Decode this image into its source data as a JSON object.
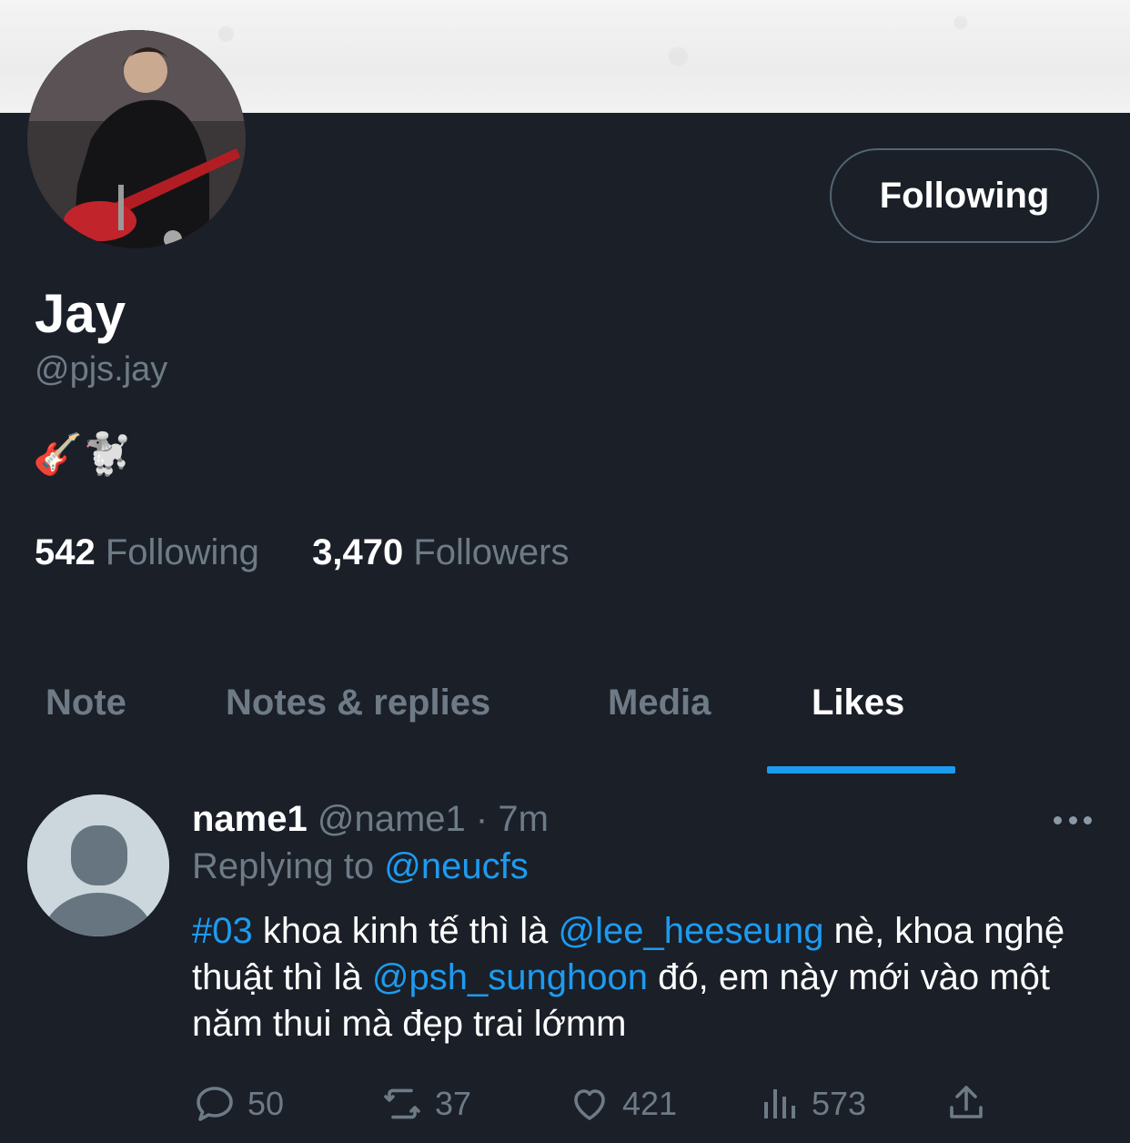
{
  "profile": {
    "display_name": "Jay",
    "handle": "@pjs.jay",
    "bio": "🎸🐩",
    "follow_button_label": "Following",
    "following_count": "542",
    "following_label": "Following",
    "followers_count": "3,470",
    "followers_label": "Followers"
  },
  "tabs": [
    {
      "label": "Note",
      "active": false
    },
    {
      "label": "Notes & replies",
      "active": false
    },
    {
      "label": "Media",
      "active": false
    },
    {
      "label": "Likes",
      "active": true
    }
  ],
  "post": {
    "author_name": "name1",
    "author_handle": "@name1",
    "separator": "·",
    "time": "7m",
    "replying_prefix": "Replying to",
    "replying_to": "@neucfs",
    "text_parts": [
      {
        "text": "#03",
        "link": true
      },
      {
        "text": " khoa kinh tế thì là ",
        "link": false
      },
      {
        "text": "@lee_heeseung",
        "link": true
      },
      {
        "text": " nè, khoa nghệ thuật thì là ",
        "link": false
      },
      {
        "text": "@psh_sunghoon",
        "link": true
      },
      {
        "text": " đó, em này mới vào một năm thui mà đẹp trai lớmm",
        "link": false
      }
    ],
    "actions": {
      "reply_count": "50",
      "repost_count": "37",
      "like_count": "421",
      "views_count": "573"
    }
  },
  "icons": {
    "reply": "reply-icon",
    "repost": "repost-icon",
    "like": "heart-icon",
    "views": "views-icon",
    "share": "share-icon",
    "more": "more-icon"
  },
  "colors": {
    "background": "#1a1f28",
    "accent": "#1d9bf0",
    "muted_text": "#6e7b86"
  }
}
